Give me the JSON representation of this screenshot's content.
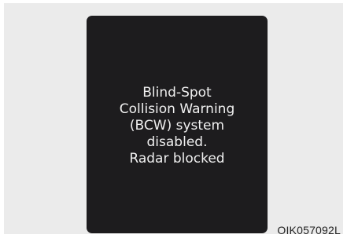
{
  "display": {
    "message_lines": [
      "Blind-Spot",
      "Collision Warning",
      "(BCW) system",
      "disabled.",
      "Radar blocked"
    ]
  },
  "figure_code": "OIK057092L",
  "colors": {
    "background": "#ebebeb",
    "display": "#1d1c1e",
    "text": "#f0f0f0"
  }
}
